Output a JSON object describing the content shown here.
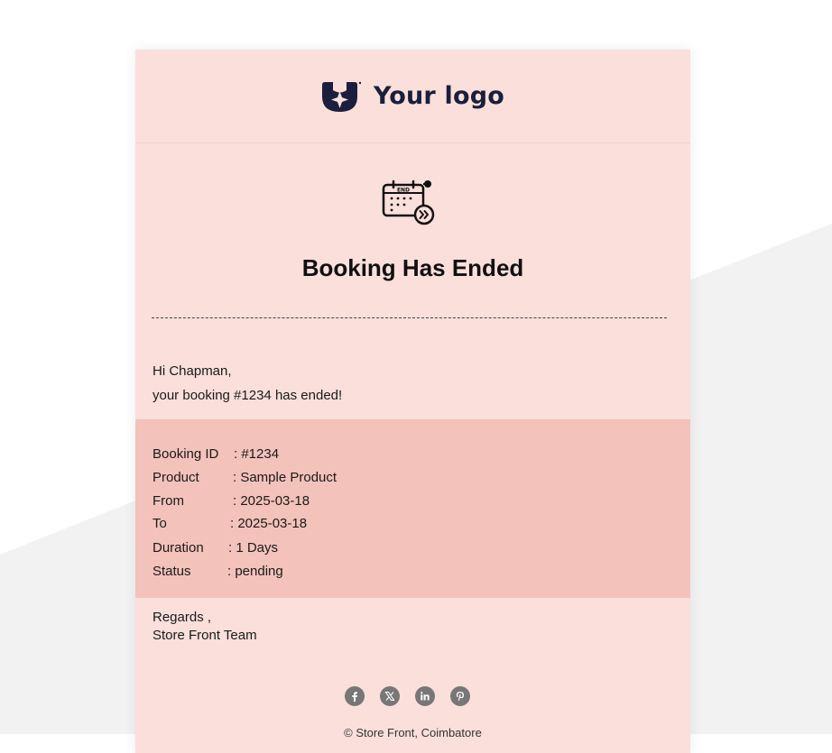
{
  "logo": {
    "text": "Your logo"
  },
  "email": {
    "title": "Booking Has Ended",
    "greeting": "Hi Chapman,",
    "message": "your booking #1234 has ended!",
    "details": [
      {
        "label": "Booking ID",
        "value": ": #1234"
      },
      {
        "label": "Product",
        "value": ": Sample Product"
      },
      {
        "label": "From",
        "value": ": 2025-03-18"
      },
      {
        "label": "To",
        "value": ": 2025-03-18"
      },
      {
        "label": "Duration",
        "value": ": 1 Days"
      },
      {
        "label": "Status",
        "value": ": pending"
      }
    ],
    "regards": "Regards ,",
    "signature": "Store Front Team",
    "footer": "© Store Front, Coimbatore"
  },
  "social": [
    "facebook-icon",
    "x-icon",
    "linkedin-icon",
    "pinterest-icon"
  ],
  "colors": {
    "card_bg": "#fadfdb",
    "details_bg": "#f3c2ba",
    "logo_navy": "#1a1f3d",
    "page_bg_shape": "#f2f2f2",
    "social_icon": "#777777"
  }
}
